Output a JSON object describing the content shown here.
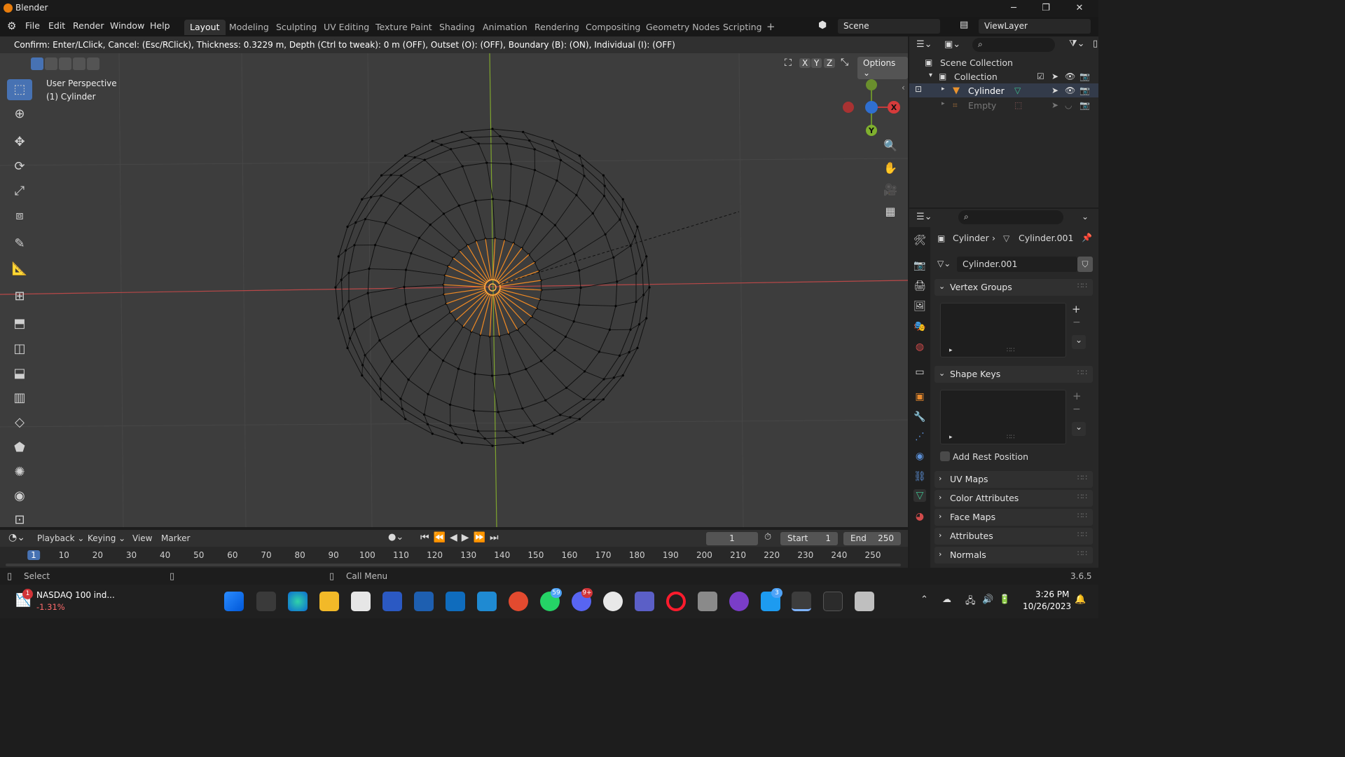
{
  "window": {
    "title": "Blender",
    "min": "─",
    "max": "❐",
    "close": "✕"
  },
  "menu": {
    "items": [
      "File",
      "Edit",
      "Render",
      "Window",
      "Help"
    ]
  },
  "workspaces": {
    "tabs": [
      "Layout",
      "Modeling",
      "Sculpting",
      "UV Editing",
      "Texture Paint",
      "Shading",
      "Animation",
      "Rendering",
      "Compositing",
      "Geometry Nodes",
      "Scripting"
    ],
    "active": "Layout",
    "add": "+"
  },
  "scene": {
    "name": "Scene",
    "view_layer": "ViewLayer"
  },
  "header_status": "Confirm: Enter/LClick, Cancel: (Esc/RClick), Thickness: 0.3229 m, Depth (Ctrl to tweak): 0 m (OFF), Outset (O): (OFF), Boundary (B): (ON), Individual (I): (OFF)",
  "viewport": {
    "perspective": "User Perspective",
    "object": "(1) Cylinder",
    "options": "Options",
    "axes": [
      "X",
      "Y",
      "Z"
    ],
    "gizmo": {
      "x": "X",
      "y": "Y"
    }
  },
  "outliner": {
    "root": "Scene Collection",
    "collection": "Collection",
    "items": [
      "Cylinder",
      "Empty"
    ]
  },
  "properties": {
    "breadcrumb": {
      "object": "Cylinder",
      "mesh": "Cylinder.001"
    },
    "mesh_name": "Cylinder.001",
    "panels": {
      "vertex_groups": "Vertex Groups",
      "shape_keys": "Shape Keys",
      "add_rest_position": "Add Rest Position",
      "uv_maps": "UV Maps",
      "color_attributes": "Color Attributes",
      "face_maps": "Face Maps",
      "attributes": "Attributes",
      "normals": "Normals"
    }
  },
  "timeline": {
    "menus": [
      "Playback",
      "Keying",
      "View",
      "Marker"
    ],
    "current_frame": "1",
    "start_label": "Start",
    "start": "1",
    "end_label": "End",
    "end": "250",
    "ticks": [
      "1",
      "10",
      "20",
      "30",
      "40",
      "50",
      "60",
      "70",
      "80",
      "90",
      "100",
      "110",
      "120",
      "130",
      "140",
      "150",
      "160",
      "170",
      "180",
      "190",
      "200",
      "210",
      "220",
      "230",
      "240",
      "250"
    ]
  },
  "statusbar": {
    "left": "Select",
    "middle": "Call Menu",
    "version": "3.6.5"
  },
  "taskbar": {
    "stock_name": "NASDAQ 100 ind...",
    "stock_change": "-1.31%",
    "stock_badge": "1",
    "time": "3:26 PM",
    "date": "10/26/2023",
    "whatsapp_badge": "59",
    "discord_badge": "9+",
    "twitter_badge": "3"
  }
}
